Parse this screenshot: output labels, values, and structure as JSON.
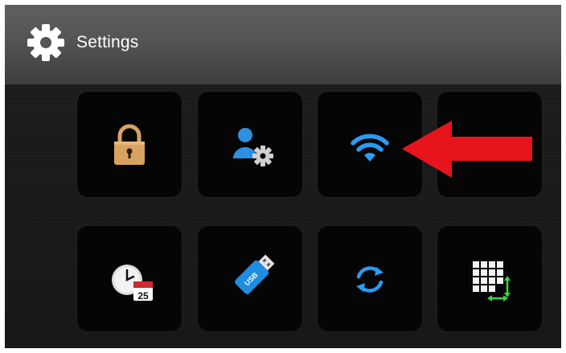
{
  "header": {
    "title": "Settings",
    "icon": "gear-icon"
  },
  "tiles": [
    {
      "id": "security",
      "icon": "padlock-icon"
    },
    {
      "id": "user-settings",
      "icon": "user-gear-icon"
    },
    {
      "id": "wifi",
      "icon": "wifi-icon"
    },
    {
      "id": "blank",
      "icon": ""
    },
    {
      "id": "date-time",
      "icon": "clock-calendar-icon",
      "calendar_day": "25"
    },
    {
      "id": "usb",
      "icon": "usb-drive-icon",
      "usb_label": "USB"
    },
    {
      "id": "sync",
      "icon": "sync-icon"
    },
    {
      "id": "keypad-size",
      "icon": "keypad-resize-icon"
    }
  ],
  "colors": {
    "accent_blue": "#1e90e0",
    "padlock": "#d8a263",
    "annotation_arrow": "#e8141c",
    "resize_arrows": "#3fd240"
  }
}
